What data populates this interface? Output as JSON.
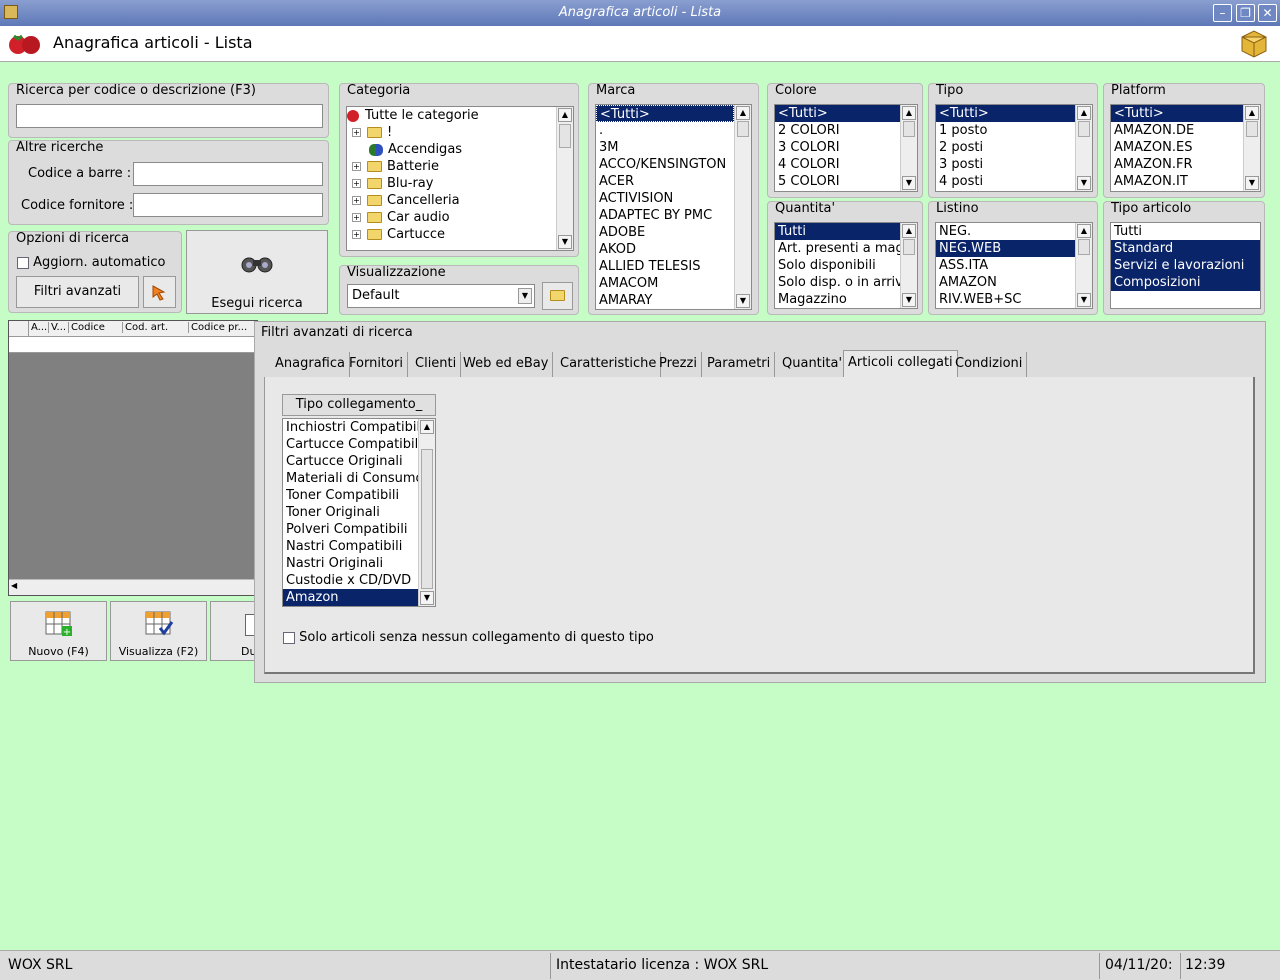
{
  "window": {
    "title": "Anagrafica articoli  - Lista"
  },
  "header": {
    "title": "Anagrafica articoli  - Lista"
  },
  "search": {
    "label": "Ricerca per codice o descrizione (F3)",
    "value": ""
  },
  "altre": {
    "label": "Altre ricerche",
    "barcode_label": "Codice a barre :",
    "supplier_label": "Codice fornitore :"
  },
  "opzioni": {
    "label": "Opzioni di ricerca",
    "auto_label": "Aggiorn. automatico",
    "filtri_label": "Filtri avanzati"
  },
  "esegui": {
    "label": "Esegui ricerca"
  },
  "categoria": {
    "label": "Categoria",
    "root": "Tutte le categorie",
    "items": [
      "!",
      "Accendigas",
      "Batterie",
      "Blu-ray",
      "Cancelleria",
      "Car audio",
      "Cartucce"
    ]
  },
  "visualizzazione": {
    "label": "Visualizzazione",
    "value": "Default"
  },
  "marca": {
    "label": "Marca",
    "items": [
      "<Tutti>",
      ".",
      "3M",
      "ACCO/KENSINGTON",
      "ACER",
      "ACTIVISION",
      "ADAPTEC BY PMC",
      "ADOBE",
      "AKOD",
      "ALLIED TELESIS",
      "AMACOM",
      "AMARAY"
    ]
  },
  "colore": {
    "label": "Colore",
    "items": [
      "<Tutti>",
      "2 COLORI",
      "3 COLORI",
      "4 COLORI",
      "5 COLORI"
    ]
  },
  "tipo": {
    "label": "Tipo",
    "items": [
      "<Tutti>",
      "1 posto",
      "2 posti",
      "3 posti",
      "4 posti"
    ]
  },
  "platform": {
    "label": "Platform",
    "items": [
      "<Tutti>",
      "AMAZON.DE",
      "AMAZON.ES",
      "AMAZON.FR",
      "AMAZON.IT"
    ]
  },
  "quantita": {
    "label": "Quantita'",
    "items": [
      "Tutti",
      "Art. presenti a magazzino",
      "Solo disponibili",
      "Solo disp. o in arrivo",
      "Magazzino"
    ]
  },
  "listino": {
    "label": "Listino",
    "items": [
      "NEG.",
      "NEG.WEB",
      "ASS.ITA",
      "AMAZON",
      "RIV.WEB+SC"
    ]
  },
  "tipo_articolo": {
    "label": "Tipo articolo",
    "items": [
      "Tutti",
      "Standard",
      "Servizi e lavorazioni",
      "Composizioni"
    ]
  },
  "grid": {
    "headers": [
      "A...",
      "V...",
      "Codice",
      "Cod. art.",
      "Codice pr..."
    ]
  },
  "bottom_buttons": {
    "nuovo": "Nuovo (F4)",
    "visualizza": "Visualizza (F2)",
    "duplica": "Du"
  },
  "filtri": {
    "title": "Filtri avanzati di ricerca",
    "tabs": [
      "Anagrafica",
      "Fornitori",
      "Clienti",
      "Web ed eBay",
      "Caratteristiche",
      "Prezzi",
      "Parametri",
      "Quantita'",
      "Articoli collegati",
      "Condizioni"
    ],
    "tipo_collegamento_header": "Tipo collegamento_",
    "tipo_items": [
      "Inchiostri Compatibili",
      "Cartucce Compatibili",
      "Cartucce Originali",
      "Materiali di Consumo",
      "Toner Compatibili",
      "Toner Originali",
      "Polveri Compatibili",
      "Nastri Compatibili",
      "Nastri Originali",
      "Custodie x CD/DVD",
      "Amazon"
    ],
    "solo_label": "Solo articoli senza nessun collegamento di questo tipo"
  },
  "status": {
    "company": "WOX SRL",
    "license": "Intestatario licenza : WOX SRL",
    "date": "04/11/20:",
    "time": "12:39"
  }
}
